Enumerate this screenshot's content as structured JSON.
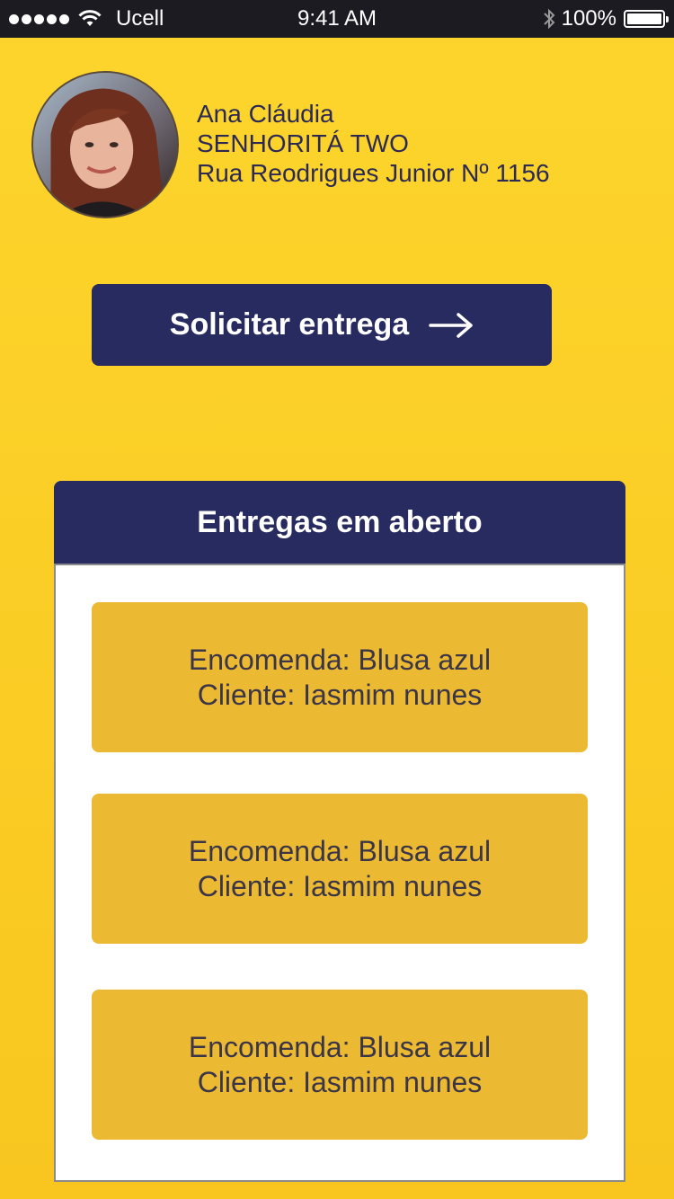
{
  "status_bar": {
    "carrier": "Ucell",
    "time": "9:41 AM",
    "battery_percent": "100%",
    "signal_icon": "signal-dots-icon",
    "wifi_icon": "wifi-icon",
    "bluetooth_icon": "bluetooth-icon",
    "battery_icon": "battery-icon"
  },
  "profile": {
    "name": "Ana Cláudia",
    "store": "SENHORITÁ TWO",
    "address": "Rua Reodrigues Junior Nº 1156"
  },
  "actions": {
    "request_delivery_label": "Solicitar entrega",
    "arrow_icon": "arrow-right-icon"
  },
  "open_deliveries": {
    "title": "Entregas em aberto",
    "items": [
      {
        "order": "Encomenda: Blusa azul",
        "client": "Cliente: Iasmim nunes"
      },
      {
        "order": "Encomenda: Blusa azul",
        "client": "Cliente: Iasmim nunes"
      },
      {
        "order": "Encomenda: Blusa azul",
        "client": "Cliente: Iasmim nunes"
      }
    ]
  },
  "colors": {
    "background": "#fdd52c",
    "primary_dark": "#282b60",
    "card": "#ecb932",
    "status_bar": "#1d1b22"
  }
}
